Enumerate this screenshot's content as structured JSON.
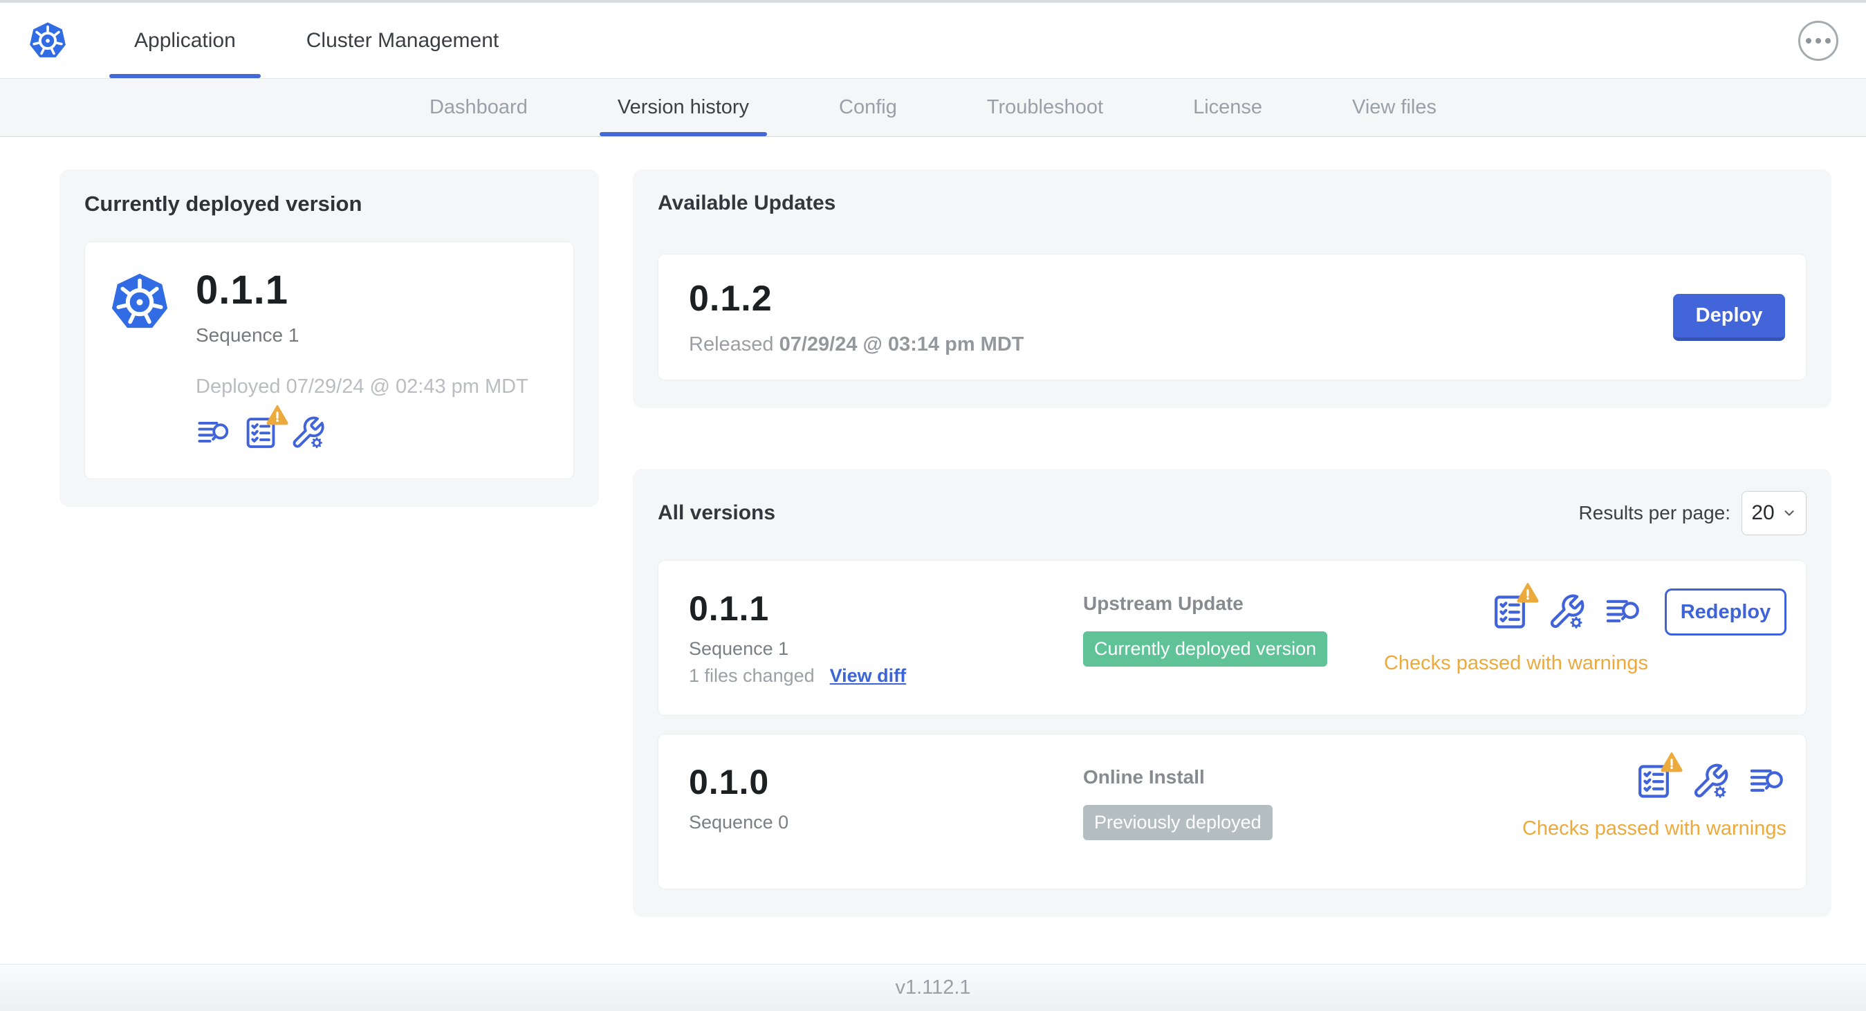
{
  "header": {
    "tabs": [
      {
        "label": "Application",
        "active": true
      },
      {
        "label": "Cluster Management",
        "active": false
      }
    ],
    "menu_icon": "ellipsis-menu-icon"
  },
  "subnav": {
    "tabs": [
      {
        "label": "Dashboard",
        "active": false
      },
      {
        "label": "Version history",
        "active": true
      },
      {
        "label": "Config",
        "active": false
      },
      {
        "label": "Troubleshoot",
        "active": false
      },
      {
        "label": "License",
        "active": false
      },
      {
        "label": "View files",
        "active": false
      }
    ]
  },
  "current_version_card": {
    "title": "Currently deployed version",
    "version": "0.1.1",
    "sequence": "Sequence 1",
    "deployed": "Deployed 07/29/24 @ 02:43 pm MDT",
    "icons": [
      "diff-lines-magnifier-icon",
      "preflight-checklist-warning-icon",
      "config-wrench-gear-icon"
    ]
  },
  "available_updates": {
    "title": "Available Updates",
    "version": "0.1.2",
    "released_label": "Released",
    "released_date": "07/29/24 @ 03:14 pm MDT",
    "deploy_label": "Deploy"
  },
  "all_versions": {
    "title": "All versions",
    "results_per_page_label": "Results per page:",
    "results_per_page_value": "20",
    "rows": [
      {
        "version": "0.1.1",
        "sequence": "Sequence 1",
        "files_changed": "1 files changed",
        "view_diff_label": "View diff",
        "source": "Upstream Update",
        "badge": "Currently deployed version",
        "badge_color": "#5fc397",
        "action_label": "Redeploy",
        "status": "Checks passed with warnings",
        "icons": [
          "preflight-checklist-warning-icon",
          "config-wrench-gear-icon",
          "diff-lines-magnifier-icon"
        ]
      },
      {
        "version": "0.1.0",
        "sequence": "Sequence 0",
        "source": "Online Install",
        "badge": "Previously deployed",
        "badge_color": "#b4bec1",
        "status": "Checks passed with warnings",
        "icons": [
          "preflight-checklist-warning-icon",
          "config-wrench-gear-icon",
          "diff-lines-magnifier-icon"
        ]
      }
    ]
  },
  "footer": {
    "version": "v1.112.1"
  },
  "colors": {
    "accent_blue": "#4369d9",
    "icon_blue": "#4063da",
    "badge_green": "#5fc397",
    "badge_gray": "#b4bec1",
    "warning_amber": "#ecaa3d",
    "panel_gray": "#f5f6f8"
  }
}
